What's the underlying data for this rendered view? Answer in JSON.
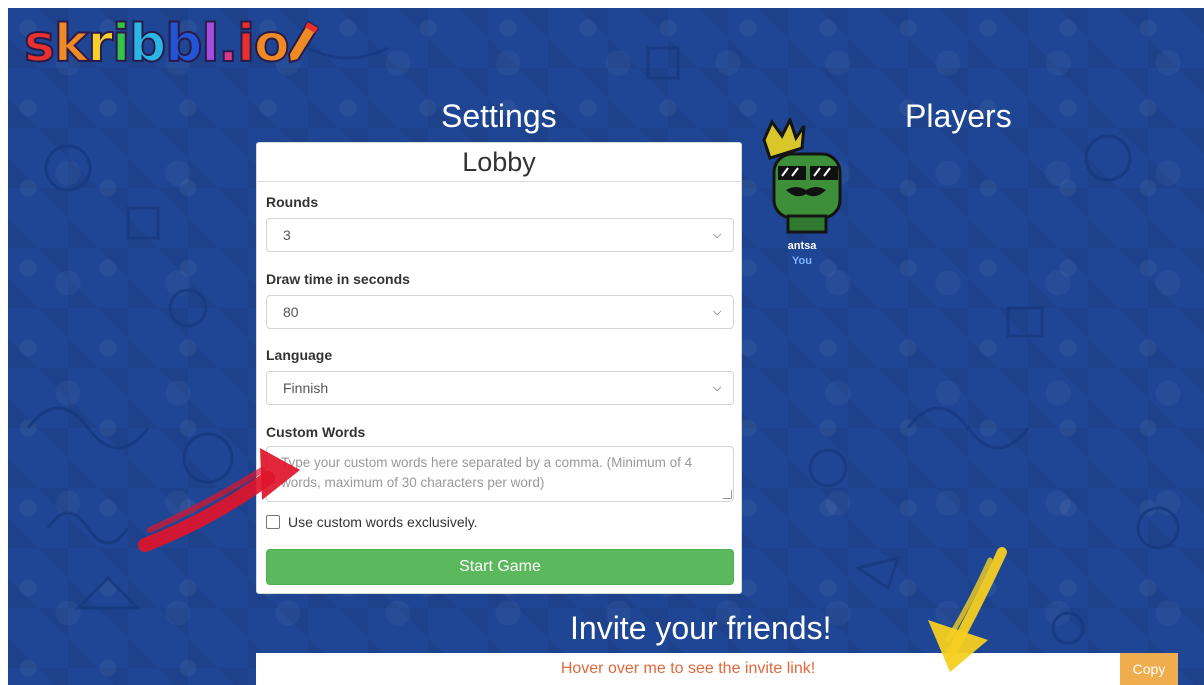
{
  "logo": {
    "letters": [
      "s",
      "k",
      "r",
      "i",
      "b",
      "b",
      "l",
      ".",
      "i",
      "o"
    ],
    "colors": [
      "#e8302f",
      "#f08a24",
      "#f6d12c",
      "#35c44a",
      "#29b8e6",
      "#2255d6",
      "#a24de0",
      "#d8398b",
      "#e8302f",
      "#f08a24"
    ],
    "pencil_icon": "pencil-icon"
  },
  "settings": {
    "title": "Settings",
    "panel_title": "Lobby",
    "rounds": {
      "label": "Rounds",
      "value": "3"
    },
    "draw_time": {
      "label": "Draw time in seconds",
      "value": "80"
    },
    "language": {
      "label": "Language",
      "value": "Finnish"
    },
    "custom_words": {
      "label": "Custom Words",
      "placeholder": "Type your custom words here separated by a comma. (Minimum of 4 words, maximum of 30 characters per word)"
    },
    "exclusive_checkbox": {
      "label": "Use custom words exclusively.",
      "checked": false
    },
    "start_button": "Start Game"
  },
  "players": {
    "title": "Players",
    "list": [
      {
        "name": "antsa",
        "tag": "You",
        "avatar_icon": "crowned-green-avatar-icon"
      }
    ]
  },
  "invite": {
    "title": "Invite your friends!",
    "link_text": "Hover over me to see the invite link!",
    "copy_button": "Copy"
  },
  "colors": {
    "background": "#1f4694",
    "start_button": "#5cb85c",
    "copy_button": "#f0ad4e",
    "invite_text": "#e2673a",
    "you_tag": "#7fb2ff"
  }
}
